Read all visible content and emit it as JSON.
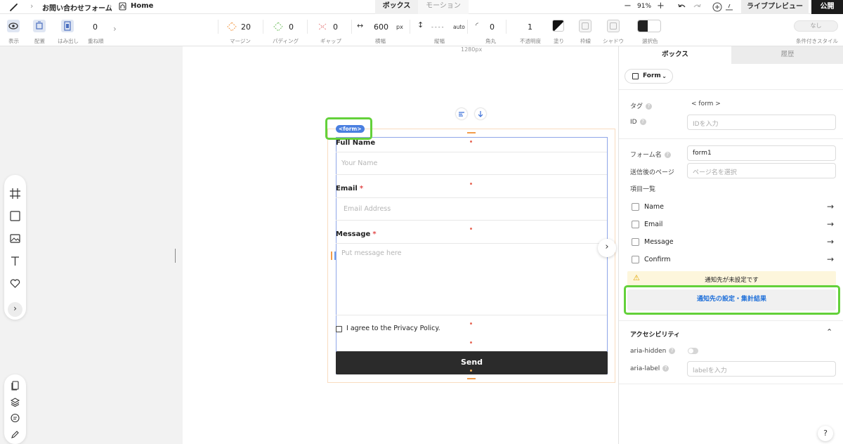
{
  "topbar": {
    "breadcrumb_project": "お問い合わせフォーム",
    "breadcrumb_page": "Home",
    "tabs": [
      {
        "label": "ボックス",
        "active": true
      },
      {
        "label": "モーション",
        "active": false
      }
    ],
    "zoom": "91%",
    "live_preview": "ライブプレビュー",
    "publish": "公開"
  },
  "propbar": {
    "view_label": "表示",
    "arrange_label": "配置",
    "overflow_label": "はみ出し",
    "zindex_value": "0",
    "zindex_label": "重ね順",
    "margin_value": "20",
    "margin_label": "マージン",
    "padding_value": "0",
    "padding_label": "パディング",
    "gap_value": "0",
    "gap_label": "ギャップ",
    "width_value": "600",
    "width_unit": "px",
    "width_label": "横幅",
    "height_value": "----",
    "height_unit": "auto",
    "height_label": "縦幅",
    "radius_value": "0",
    "radius_label": "角丸",
    "opacity_value": "1",
    "opacity_label": "不透明度",
    "fill_label": "塗り",
    "border_label": "枠線",
    "shadow_label": "シャドウ",
    "selected_color_label": "選択色",
    "conditional_value": "なし",
    "conditional_label": "条件付きスタイル"
  },
  "canvas": {
    "width_indicator": "1280px",
    "form_tag": "<form>",
    "fields": [
      {
        "label": "Full Name",
        "placeholder": "Your Name",
        "required": false
      },
      {
        "label": "Email",
        "placeholder": "Email Address",
        "required": true
      },
      {
        "label": "Message",
        "placeholder": "Put message here",
        "required": true
      }
    ],
    "required_mark": "*",
    "agree_text": "I agree to the Privacy Policy.",
    "send_label": "Send"
  },
  "panel": {
    "tabs": [
      {
        "label": "ボックス",
        "active": true
      },
      {
        "label": "履歴",
        "active": false
      }
    ],
    "element_type": "Form",
    "tag_label": "タグ",
    "tag_value": "< form >",
    "id_label": "ID",
    "id_placeholder": "IDを入力",
    "form_name_label": "フォーム名",
    "form_name_value": "form1",
    "redirect_label": "送信後のページ",
    "redirect_placeholder": "ページ名を選択",
    "items_label": "項目一覧",
    "items": [
      "Name",
      "Email",
      "Message",
      "Confirm"
    ],
    "warning_text": "通知先が未設定です",
    "notify_button": "通知先の設定・集計結果",
    "accessibility_title": "アクセシビリティ",
    "aria_hidden_label": "aria-hidden",
    "aria_label_label": "aria-label",
    "aria_label_placeholder": "labelを入力",
    "help_button": "?"
  },
  "colors": {
    "accent_green": "#63d13a",
    "tag_blue": "#4a7fe0",
    "send_bg": "#2b2b2b",
    "link_blue": "#1e6fd9",
    "warning_bg": "#fdf6dc"
  }
}
